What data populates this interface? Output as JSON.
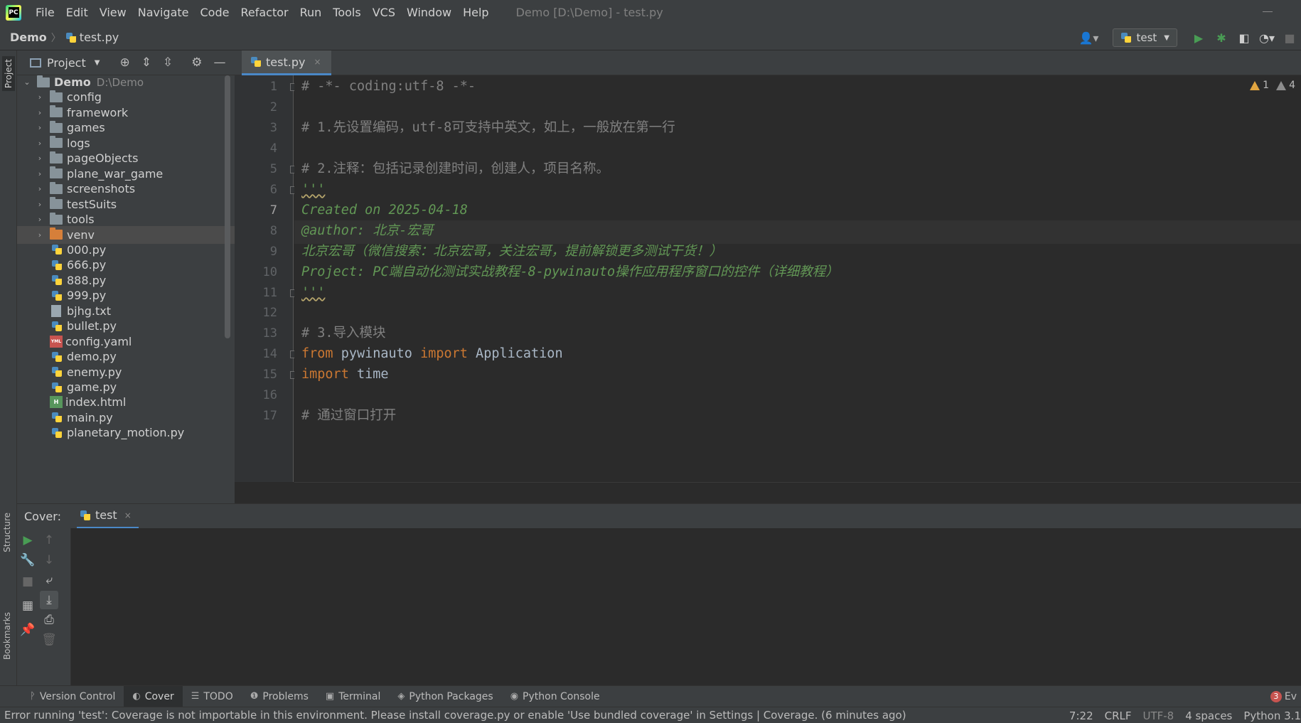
{
  "menubar": {
    "logo": "PC",
    "items": [
      "File",
      "Edit",
      "View",
      "Navigate",
      "Code",
      "Refactor",
      "Run",
      "Tools",
      "VCS",
      "Window",
      "Help"
    ],
    "title": "Demo [D:\\Demo] - test.py"
  },
  "navbar": {
    "root": "Demo",
    "separator": "〉",
    "file": "test.py",
    "run_config": "test"
  },
  "icons": {
    "user": "user-icon",
    "run": "run-icon",
    "debug": "debug-icon",
    "coverage": "coverage-icon",
    "profile": "profile-icon",
    "stop": "stop-icon",
    "locate": "locate-icon",
    "expand": "expand-all-icon",
    "collapse": "collapse-all-icon",
    "gear": "gear-icon",
    "hide": "minimize-icon"
  },
  "left_stripe": {
    "project": "Project",
    "structure": "Structure",
    "bookmarks": "Bookmarks"
  },
  "project_panel": {
    "title": "Project",
    "tree": [
      {
        "name": "Demo",
        "hint": "D:\\Demo",
        "kind": "root",
        "level": 0,
        "expanded": true
      },
      {
        "name": "config",
        "kind": "folder",
        "level": 1
      },
      {
        "name": "framework",
        "kind": "folder",
        "level": 1
      },
      {
        "name": "games",
        "kind": "folder",
        "level": 1
      },
      {
        "name": "logs",
        "kind": "folder",
        "level": 1
      },
      {
        "name": "pageObjects",
        "kind": "folder",
        "level": 1
      },
      {
        "name": "plane_war_game",
        "kind": "folder",
        "level": 1
      },
      {
        "name": "screenshots",
        "kind": "folder",
        "level": 1
      },
      {
        "name": "testSuits",
        "kind": "folder",
        "level": 1
      },
      {
        "name": "tools",
        "kind": "folder",
        "level": 1
      },
      {
        "name": "venv",
        "kind": "folder-orange",
        "level": 1,
        "selected": true
      },
      {
        "name": "000.py",
        "kind": "py",
        "level": 1
      },
      {
        "name": "666.py",
        "kind": "py",
        "level": 1
      },
      {
        "name": "888.py",
        "kind": "py",
        "level": 1
      },
      {
        "name": "999.py",
        "kind": "py",
        "level": 1
      },
      {
        "name": "bjhg.txt",
        "kind": "txt",
        "level": 1
      },
      {
        "name": "bullet.py",
        "kind": "py",
        "level": 1
      },
      {
        "name": "config.yaml",
        "kind": "yaml",
        "level": 1
      },
      {
        "name": "demo.py",
        "kind": "py",
        "level": 1
      },
      {
        "name": "enemy.py",
        "kind": "py",
        "level": 1
      },
      {
        "name": "game.py",
        "kind": "py",
        "level": 1
      },
      {
        "name": "index.html",
        "kind": "html",
        "level": 1
      },
      {
        "name": "main.py",
        "kind": "py",
        "level": 1
      },
      {
        "name": "planetary_motion.py",
        "kind": "py",
        "level": 1
      }
    ]
  },
  "editor": {
    "tab_label": "test.py",
    "tab_close": "×",
    "current_line": 7,
    "warnings_a": "1",
    "warnings_b": "4",
    "lines": [
      {
        "n": 1,
        "tokens": [
          {
            "t": "# -*- coding:utf-8 -*-",
            "c": "comment"
          }
        ]
      },
      {
        "n": 2,
        "tokens": []
      },
      {
        "n": 3,
        "tokens": [
          {
            "t": "# 1.先设置编码，utf-8可支持中英文，如上，一般放在第一行",
            "c": "comment"
          }
        ]
      },
      {
        "n": 4,
        "tokens": []
      },
      {
        "n": 5,
        "tokens": [
          {
            "t": "# 2.注释：包括记录创建时间，创建人，项目名称。",
            "c": "comment"
          }
        ]
      },
      {
        "n": 6,
        "tokens": [
          {
            "t": "'''",
            "c": "doc-squiggle"
          }
        ]
      },
      {
        "n": 7,
        "tokens": [
          {
            "t": "Created on 2025-04-18",
            "c": "doc"
          }
        ]
      },
      {
        "n": 8,
        "tokens": [
          {
            "t": "@author: 北京-宏哥",
            "c": "doc"
          }
        ]
      },
      {
        "n": 9,
        "tokens": [
          {
            "t": "北京宏哥（微信搜索：北京宏哥，关注宏哥，提前解锁更多测试干货！）",
            "c": "doc"
          }
        ]
      },
      {
        "n": 10,
        "tokens": [
          {
            "t": "Project: PC端自动化测试实战教程-8-pywinauto操作应用程序窗口的控件（详细教程）",
            "c": "doc"
          }
        ]
      },
      {
        "n": 11,
        "tokens": [
          {
            "t": "'''",
            "c": "doc-squiggle"
          }
        ]
      },
      {
        "n": 12,
        "tokens": []
      },
      {
        "n": 13,
        "tokens": [
          {
            "t": "# 3.导入模块",
            "c": "comment"
          }
        ]
      },
      {
        "n": 14,
        "tokens": [
          {
            "t": "from",
            "c": "kw"
          },
          {
            "t": " pywinauto ",
            "c": "id"
          },
          {
            "t": "import",
            "c": "kw"
          },
          {
            "t": " Application",
            "c": "id"
          }
        ]
      },
      {
        "n": 15,
        "tokens": [
          {
            "t": "import",
            "c": "kw"
          },
          {
            "t": " time",
            "c": "id"
          }
        ]
      },
      {
        "n": 16,
        "tokens": []
      },
      {
        "n": 17,
        "tokens": [
          {
            "t": "# 通过窗口打开",
            "c": "comment"
          }
        ]
      }
    ],
    "fold_lines": [
      1,
      5,
      6,
      11,
      14,
      15
    ]
  },
  "cover": {
    "title": "Cover:",
    "tab": "test",
    "tab_close": "×"
  },
  "tool_windows": [
    {
      "label": "Version Control",
      "icon": "ᚹ",
      "active": false
    },
    {
      "label": "Cover",
      "icon": "◐",
      "active": true
    },
    {
      "label": "TODO",
      "icon": "☰",
      "active": false
    },
    {
      "label": "Problems",
      "icon": "❶",
      "active": false
    },
    {
      "label": "Terminal",
      "icon": "▣",
      "active": false
    },
    {
      "label": "Python Packages",
      "icon": "◈",
      "active": false
    },
    {
      "label": "Python Console",
      "icon": "◉",
      "active": false
    }
  ],
  "event_log": {
    "count": "3",
    "label": "Ev"
  },
  "statusbar": {
    "message": "Error running 'test': Coverage is not importable in this environment. Please install coverage.py or enable 'Use bundled coverage' in Settings | Coverage. (6 minutes ago)",
    "position": "7:22",
    "line_sep": "CRLF",
    "encoding": "UTF-8",
    "indent": "4 spaces",
    "interpreter": "Python 3.1"
  },
  "colors": {
    "bg": "#2b2b2b",
    "panel": "#3c3f41",
    "comment": "#808080",
    "docstring": "#629755",
    "keyword": "#cc7832",
    "identifier": "#a9b7c6",
    "accent": "#4a88c7",
    "run_green": "#499c54"
  }
}
